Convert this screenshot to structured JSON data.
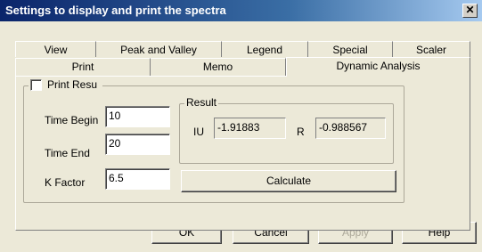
{
  "window": {
    "title": "Settings to display and print the spectra",
    "close_glyph": "✕"
  },
  "tabs": {
    "row1": [
      "View",
      "Peak and Valley",
      "Legend",
      "Special",
      "Scaler"
    ],
    "row2": [
      "Print",
      "Memo",
      "Dynamic Analysis"
    ],
    "active": "Dynamic Analysis"
  },
  "print_result": {
    "label": "Print Resu",
    "checked": false
  },
  "inputs": {
    "time_begin_label": "Time Begin",
    "time_begin_value": "10",
    "time_end_label": "Time End",
    "time_end_value": "20",
    "k_factor_label": "K Factor",
    "k_factor_value": "6.5"
  },
  "result": {
    "label": "Result",
    "iu_label": "IU",
    "iu_value": "-1.91883",
    "r_label": "R",
    "r_value": "-0.988567",
    "calculate_label": "Calculate"
  },
  "buttons": {
    "ok": "OK",
    "cancel": "Cancel",
    "apply": "Apply",
    "help": "Help"
  }
}
